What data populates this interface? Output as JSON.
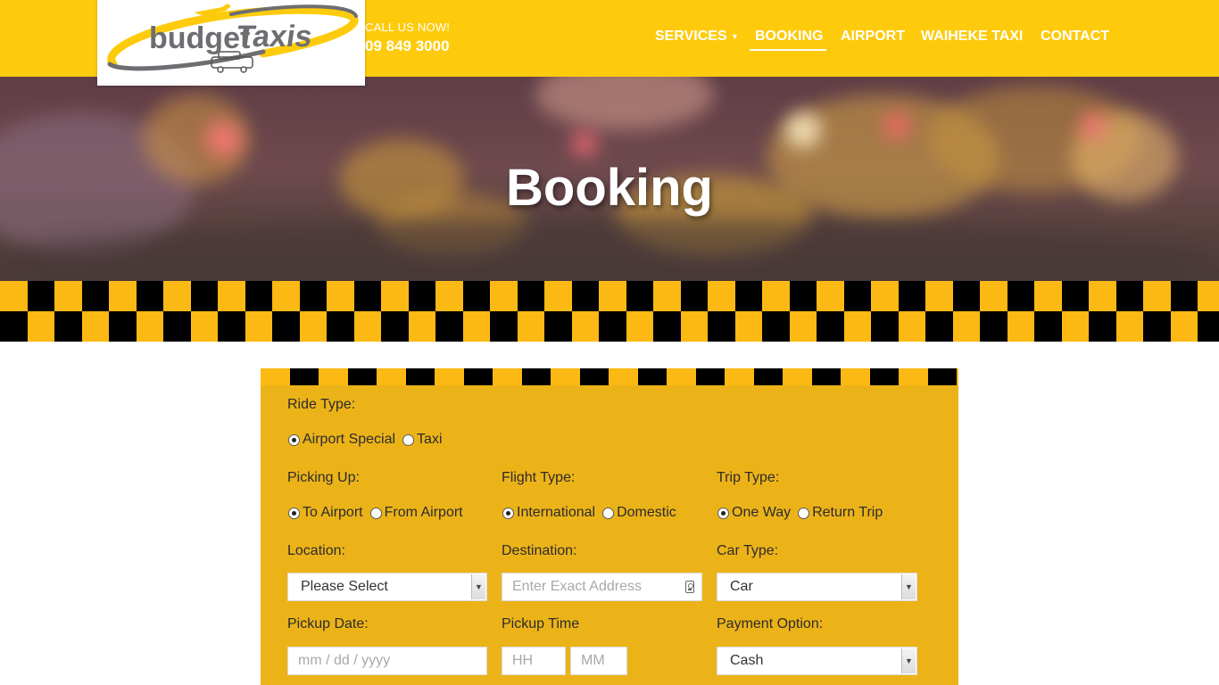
{
  "header": {
    "logo": {
      "word1": "budget",
      "word2": "Taxis"
    },
    "call_label": "CALL US NOW!",
    "phone": "09 849 3000",
    "nav": [
      "SERVICES",
      "BOOKING",
      "AIRPORT",
      "WAIHEKE TAXI",
      "CONTACT"
    ],
    "active_nav": "BOOKING"
  },
  "hero": {
    "title": "Booking"
  },
  "form": {
    "ride_type": {
      "label": "Ride Type:",
      "options": [
        "Airport Special",
        "Taxi"
      ],
      "selected": "Airport Special"
    },
    "picking_up": {
      "label": "Picking Up:",
      "options": [
        "To Airport",
        "From Airport"
      ],
      "selected": "To Airport"
    },
    "flight_type": {
      "label": "Flight Type:",
      "options": [
        "International",
        "Domestic"
      ],
      "selected": "International"
    },
    "trip_type": {
      "label": "Trip Type:",
      "options": [
        "One Way",
        "Return Trip"
      ],
      "selected": "One Way"
    },
    "location": {
      "label": "Location:",
      "value": "Please Select"
    },
    "destination": {
      "label": "Destination:",
      "placeholder": "Enter Exact Address"
    },
    "car_type": {
      "label": "Car Type:",
      "value": "Car"
    },
    "pickup_date": {
      "label": "Pickup Date:",
      "placeholder": "mm / dd / yyyy"
    },
    "pickup_time": {
      "label": "Pickup Time",
      "hh_placeholder": "HH",
      "mm_placeholder": "MM"
    },
    "payment": {
      "label": "Payment Option:",
      "value": "Cash"
    }
  },
  "colors": {
    "brand_yellow": "#fecb0c",
    "form_yellow": "#ecb319",
    "checker_yellow": "#fdb913",
    "checker_black": "#000000"
  }
}
